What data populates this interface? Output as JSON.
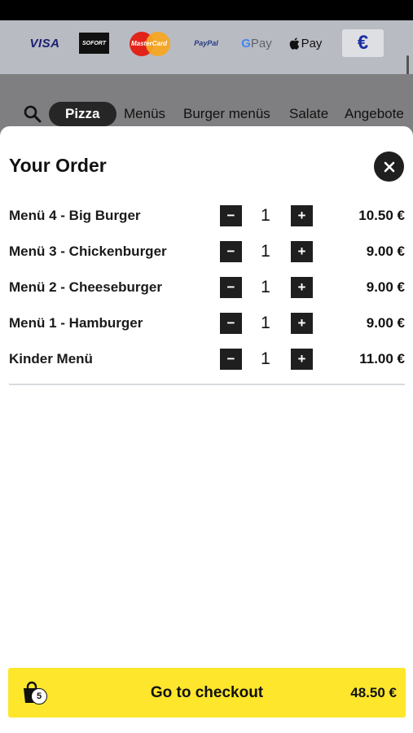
{
  "payment_methods": {
    "visa": "VISA",
    "sofort": "SOFORT",
    "mastercard": "MasterCard",
    "paypal": "PayPal",
    "gpay_g": "G",
    "gpay_rest": "Pay",
    "applepay": "Pay",
    "currency_symbol": "€"
  },
  "categories": [
    {
      "label": "Pizza",
      "active": true
    },
    {
      "label": "Menüs",
      "active": false
    },
    {
      "label": "Burger menüs",
      "active": false
    },
    {
      "label": "Salate",
      "active": false
    },
    {
      "label": "Angebote",
      "active": false
    }
  ],
  "order": {
    "title": "Your Order",
    "minus_label": "−",
    "plus_label": "+",
    "items": [
      {
        "name": "Menü 4 - Big Burger",
        "qty": "1",
        "price": "10.50 €"
      },
      {
        "name": "Menü 3 - Chickenburger",
        "qty": "1",
        "price": "9.00 €"
      },
      {
        "name": "Menü 2 - Cheeseburger",
        "qty": "1",
        "price": "9.00 €"
      },
      {
        "name": "Menü 1 - Hamburger",
        "qty": "1",
        "price": "9.00 €"
      },
      {
        "name": "Kinder Menü",
        "qty": "1",
        "price": "11.00 €"
      }
    ]
  },
  "checkout": {
    "label": "Go to checkout",
    "item_count": "5",
    "total": "48.50 €"
  },
  "colors": {
    "accent": "#fde62c",
    "dark": "#1f1f1f"
  }
}
